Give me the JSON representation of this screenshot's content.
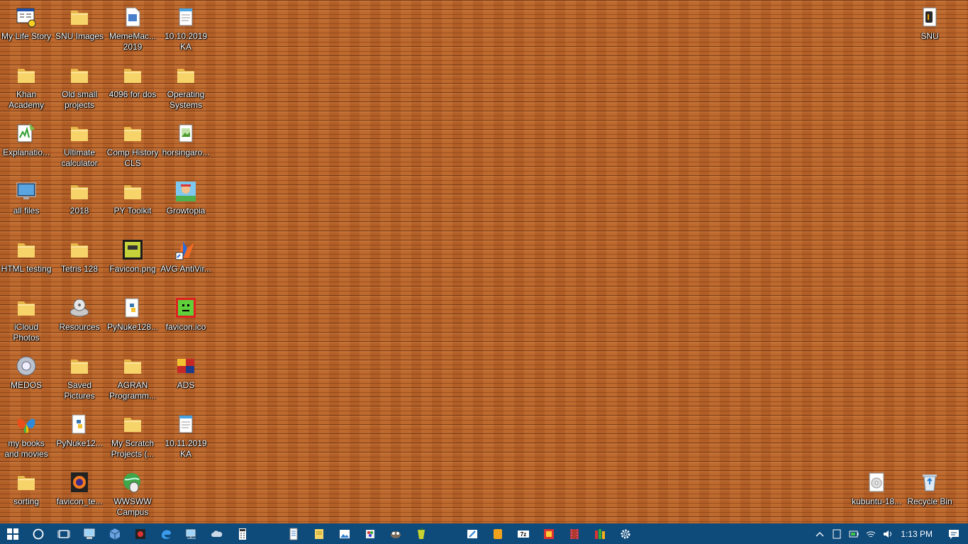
{
  "desktop": {
    "icons": [
      {
        "label": "My Life Story",
        "icon": "app-window-icon"
      },
      {
        "label": "SNU Images",
        "icon": "folder-icon"
      },
      {
        "label": "MemeMac... 2019",
        "icon": "document-icon"
      },
      {
        "label": "10.10.2019 KA",
        "icon": "notepad-icon"
      },
      {
        "label": "SNU",
        "icon": "audio-file-icon"
      },
      {
        "label": "Khan Academy",
        "icon": "folder-icon"
      },
      {
        "label": "Old small projects",
        "icon": "folder-icon"
      },
      {
        "label": "4096 for dos",
        "icon": "folder-icon"
      },
      {
        "label": "Operating Systems",
        "icon": "folder-icon"
      },
      {
        "label": "Explanatio...",
        "icon": "notepad-plus-icon"
      },
      {
        "label": "Ultimate calculator",
        "icon": "folder-icon"
      },
      {
        "label": "Comp History CLS",
        "icon": "folder-icon"
      },
      {
        "label": "horsingaro...",
        "icon": "image-file-icon"
      },
      {
        "label": "all files",
        "icon": "monitor-icon"
      },
      {
        "label": "2018",
        "icon": "folder-icon"
      },
      {
        "label": "PY Toolkit",
        "icon": "folder-icon"
      },
      {
        "label": "Growtopia",
        "icon": "growtopia-icon"
      },
      {
        "label": "HTML testing",
        "icon": "folder-icon"
      },
      {
        "label": "Tetris 128",
        "icon": "folder-icon"
      },
      {
        "label": "Favicon.png",
        "icon": "favicon-png-icon"
      },
      {
        "label": "AVG AntiVir...",
        "icon": "avg-icon"
      },
      {
        "label": "iCloud Photos",
        "icon": "folder-icon"
      },
      {
        "label": "Resources",
        "icon": "drive-icon"
      },
      {
        "label": "PyNuke128...",
        "icon": "python-file-icon"
      },
      {
        "label": "favicon.ico",
        "icon": "favicon-ico-icon"
      },
      {
        "label": "MEDOS",
        "icon": "gear-disc-icon"
      },
      {
        "label": "Saved Pictures",
        "icon": "folder-icon"
      },
      {
        "label": "AGRAN Programm...",
        "icon": "folder-icon"
      },
      {
        "label": "ADS",
        "icon": "ads-icon"
      },
      {
        "label": "my books and movies",
        "icon": "butterfly-icon"
      },
      {
        "label": "PyNuke12...",
        "icon": "python-file-icon"
      },
      {
        "label": "My Scratch Projects (...",
        "icon": "folder-icon"
      },
      {
        "label": "10.11.2019 KA",
        "icon": "notepad-icon"
      },
      {
        "label": "sorting",
        "icon": "folder-icon"
      },
      {
        "label": "favicon_te...",
        "icon": "firefox-file-icon"
      },
      {
        "label": "WWSWW Campus",
        "icon": "globe-mouse-icon"
      },
      {
        "label": "kubuntu-18...",
        "icon": "disc-image-icon"
      },
      {
        "label": "Recycle Bin",
        "icon": "recycle-bin-icon"
      }
    ]
  },
  "taskbar": {
    "apps": [
      {
        "name": "start-button",
        "icon": "windows-logo-icon"
      },
      {
        "name": "search-button",
        "icon": "cortana-circle-icon"
      },
      {
        "name": "task-view-button",
        "icon": "task-view-icon"
      },
      {
        "name": "taskbar-app-computer",
        "icon": "computer-icon"
      },
      {
        "name": "taskbar-app-cube",
        "icon": "cube-icon"
      },
      {
        "name": "taskbar-app-media",
        "icon": "media-icon"
      },
      {
        "name": "taskbar-app-edge",
        "icon": "edge-icon"
      },
      {
        "name": "taskbar-app-network",
        "icon": "network-computer-icon"
      },
      {
        "name": "taskbar-app-cloud",
        "icon": "cloud-icon"
      },
      {
        "name": "taskbar-app-calculator",
        "icon": "calculator-icon"
      },
      {
        "name": "taskbar-app-notepad",
        "icon": "notepad-icon"
      },
      {
        "name": "taskbar-app-documents",
        "icon": "documents-icon"
      },
      {
        "name": "taskbar-app-sticky",
        "icon": "sticky-note-icon"
      },
      {
        "name": "taskbar-app-photos",
        "icon": "photos-icon"
      },
      {
        "name": "taskbar-app-paint",
        "icon": "paint-icon"
      },
      {
        "name": "taskbar-app-gimp",
        "icon": "gimp-icon"
      },
      {
        "name": "taskbar-app-cup",
        "icon": "cup-icon"
      },
      {
        "name": "taskbar-app-monitor",
        "icon": "monitor-icon"
      },
      {
        "name": "taskbar-app-tool",
        "icon": "tool-icon"
      },
      {
        "name": "taskbar-app-orange",
        "icon": "orange-box-icon"
      },
      {
        "name": "taskbar-app-7zip",
        "icon": "7zip-icon"
      },
      {
        "name": "taskbar-app-game",
        "icon": "game-icon"
      },
      {
        "name": "taskbar-app-film",
        "icon": "film-icon"
      },
      {
        "name": "taskbar-app-books",
        "icon": "books-icon"
      },
      {
        "name": "taskbar-app-settings",
        "icon": "gear-icon"
      }
    ],
    "tray": {
      "icons": [
        "chevron-up-icon",
        "tablet-icon",
        "battery-icon",
        "wifi-icon",
        "volume-icon"
      ],
      "clock": "1:13 PM",
      "notification_icon": "notification-icon"
    }
  },
  "colors": {
    "taskbar_bg": "#0e4a7a",
    "desktop_wood": "#b8642a",
    "folder": "#f2c95b"
  }
}
